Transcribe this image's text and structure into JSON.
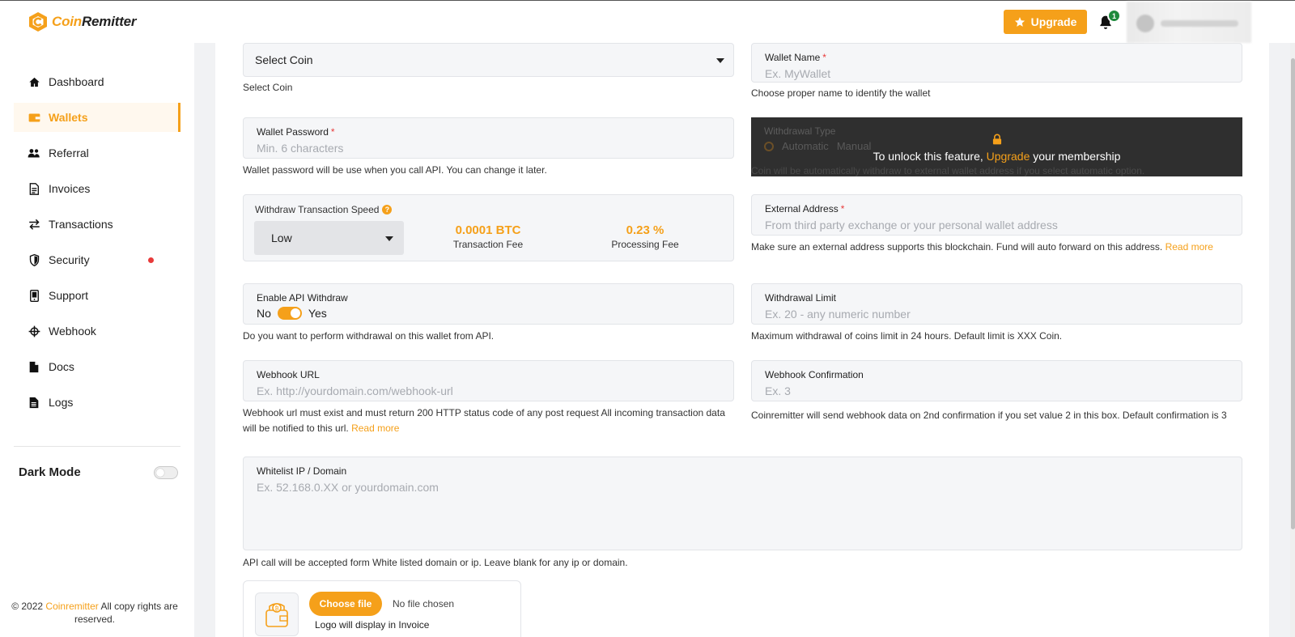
{
  "brand": {
    "logo_left": "Coin",
    "logo_right": "Remitter",
    "accent_color": "#f5a01a"
  },
  "topbar": {
    "upgrade_label": "Upgrade",
    "notification_count": "1"
  },
  "sidebar": {
    "items": [
      {
        "label": "Dashboard",
        "icon": "home-icon"
      },
      {
        "label": "Wallets",
        "icon": "wallet-icon",
        "active": true
      },
      {
        "label": "Referral",
        "icon": "users-icon"
      },
      {
        "label": "Invoices",
        "icon": "invoice-icon"
      },
      {
        "label": "Transactions",
        "icon": "transfer-icon"
      },
      {
        "label": "Security",
        "icon": "shield-icon"
      },
      {
        "label": "Support",
        "icon": "support-icon"
      },
      {
        "label": "Webhook",
        "icon": "webhook-icon"
      },
      {
        "label": "Docs",
        "icon": "doc-icon"
      },
      {
        "label": "Logs",
        "icon": "log-icon"
      }
    ],
    "dark_mode_label": "Dark Mode",
    "footer_prefix": "© 2022 ",
    "footer_brand": "Coinremitter",
    "footer_suffix": " All copy rights are reserved."
  },
  "form": {
    "coin": {
      "value": "Select Coin",
      "help": "Select Coin"
    },
    "wallet_name": {
      "label": "Wallet Name",
      "placeholder": "Ex. MyWallet",
      "help": "Choose proper name to identify the wallet"
    },
    "wallet_password": {
      "label": "Wallet Password",
      "placeholder": "Min. 6 characters",
      "help": "Wallet password will be use when you call API. You can change it later."
    },
    "withdrawal_type": {
      "label": "Withdrawal Type",
      "option_automatic": "Automatic",
      "option_manual": "Manual",
      "help": "Coin will be automatically withdraw to external wallet address if you select automatic option.",
      "locked_prefix": "To unlock this feature, ",
      "locked_link": "Upgrade",
      "locked_suffix": " your membership"
    },
    "speed": {
      "label": "Withdraw Transaction Speed",
      "value": "Low",
      "transaction_fee_value": "0.0001 BTC",
      "transaction_fee_label": "Transaction Fee",
      "processing_fee_value": "0.23 %",
      "processing_fee_label": "Processing Fee"
    },
    "external_address": {
      "label": "External Address",
      "placeholder": "From third party exchange or your personal wallet address",
      "help": "Make sure an external address supports this blockchain. Fund will auto forward on this address. ",
      "help_link": "Read more"
    },
    "api_withdraw": {
      "label": "Enable API Withdraw",
      "no": "No",
      "yes": "Yes",
      "enabled": true,
      "help": "Do you want to perform withdrawal on this wallet from API."
    },
    "withdrawal_limit": {
      "label": "Withdrawal Limit",
      "placeholder": "Ex. 20 - any numeric number",
      "help": "Maximum withdrawal of coins limit in 24 hours. Default limit is XXX Coin."
    },
    "webhook_url": {
      "label": "Webhook URL",
      "placeholder": "Ex. http://yourdomain.com/webhook-url",
      "help": "Webhook url must exist and must return 200 HTTP status code of any post request All incoming transaction data will be notified to this url. ",
      "help_link": "Read more"
    },
    "webhook_confirmation": {
      "label": "Webhook Confirmation",
      "placeholder": "Ex. 3",
      "help": "Coinremitter will send webhook data on 2nd confirmation if you set value 2 in this box. Default confirmation is 3"
    },
    "whitelist": {
      "label": "Whitelist IP / Domain",
      "placeholder": "Ex. 52.168.0.XX or yourdomain.com",
      "help": "API call will be accepted form White listed domain or ip. Leave blank for any ip or domain."
    },
    "logo_upload": {
      "button": "Choose file",
      "status": "No file chosen",
      "note": "Logo will display in Invoice"
    }
  }
}
